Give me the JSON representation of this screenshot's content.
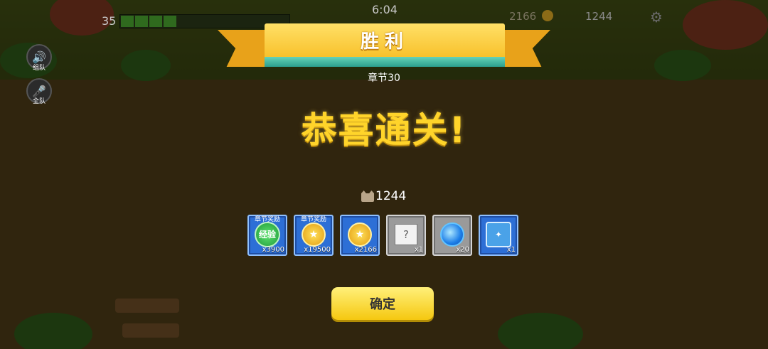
{
  "hud": {
    "level": "35",
    "timer": "6:04",
    "coins": "2166",
    "fish": "1244",
    "voice_team_label": "组队",
    "voice_all_label": "全队"
  },
  "result": {
    "banner_title": "胜利",
    "chapter": "章节30",
    "congrats": "恭喜通关!",
    "fish_total": "1244"
  },
  "rewards": [
    {
      "tag": "章节奖励",
      "icon": "exp-icon",
      "icon_text": "经验",
      "qty": "x3900",
      "rarity": "blue"
    },
    {
      "tag": "章节奖励",
      "icon": "coin-icon",
      "qty": "x19500",
      "rarity": "blue"
    },
    {
      "tag": "",
      "icon": "coin-icon",
      "qty": "x2166",
      "rarity": "blue"
    },
    {
      "tag": "",
      "icon": "mystery-scroll-icon",
      "qty": "x1",
      "rarity": "gray"
    },
    {
      "tag": "",
      "icon": "blue-swirl-icon",
      "qty": "x20",
      "rarity": "gray"
    },
    {
      "tag": "",
      "icon": "treasure-chest-icon",
      "qty": "x1",
      "rarity": "blue"
    }
  ],
  "confirm_label": "确定",
  "colors": {
    "gold": "#ffd42a",
    "ribbon": "#f6b91c",
    "ribbon_band": "#2c9f8e",
    "item_blue": "#2d6fd6",
    "item_gray": "#9a9a9a",
    "button": "#f5c810"
  }
}
